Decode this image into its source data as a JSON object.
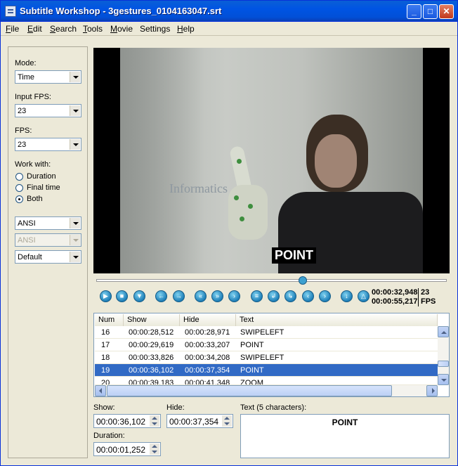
{
  "window": {
    "title": "Subtitle Workshop - 3gestures_0104163047.srt",
    "min": "_",
    "max": "□",
    "close": "✕"
  },
  "menu": [
    "File",
    "Edit",
    "Search",
    "Tools",
    "Movie",
    "Settings",
    "Help"
  ],
  "left": {
    "mode_label": "Mode:",
    "mode_value": "Time",
    "input_fps_label": "Input FPS:",
    "input_fps_value": "23",
    "fps_label": "FPS:",
    "fps_value": "23",
    "work_with_label": "Work with:",
    "options": [
      "Duration",
      "Final time",
      "Both"
    ],
    "selected_option": "Both",
    "encoding1": "ANSI",
    "encoding2": "ANSI",
    "format": "Default"
  },
  "video": {
    "subtitle": "POINT",
    "shirt_text": "Informatics",
    "progress": 0.6
  },
  "player": {
    "current_time": "00:00:32,948",
    "total_time": "00:00:55,217",
    "fps_value": "23",
    "fps_unit": "FPS"
  },
  "table": {
    "headers": [
      "Num",
      "Show",
      "Hide",
      "Text"
    ],
    "rows": [
      {
        "num": "16",
        "show": "00:00:28,512",
        "hide": "00:00:28,971",
        "text": "SWIPELEFT"
      },
      {
        "num": "17",
        "show": "00:00:29,619",
        "hide": "00:00:33,207",
        "text": "POINT"
      },
      {
        "num": "18",
        "show": "00:00:33,826",
        "hide": "00:00:34,208",
        "text": "SWIPELEFT"
      },
      {
        "num": "19",
        "show": "00:00:36,102",
        "hide": "00:00:37,354",
        "text": "POINT"
      },
      {
        "num": "20",
        "show": "00:00:39,183",
        "hide": "00:00:41,348",
        "text": "ZOOM"
      }
    ],
    "selected_row": "19"
  },
  "editor": {
    "show_label": "Show:",
    "show_value": "00:00:36,102",
    "hide_label": "Hide:",
    "hide_value": "00:00:37,354",
    "duration_label": "Duration:",
    "duration_value": "00:00:01,252",
    "text_label": "Text (5 characters):",
    "text_value": "POINT"
  }
}
